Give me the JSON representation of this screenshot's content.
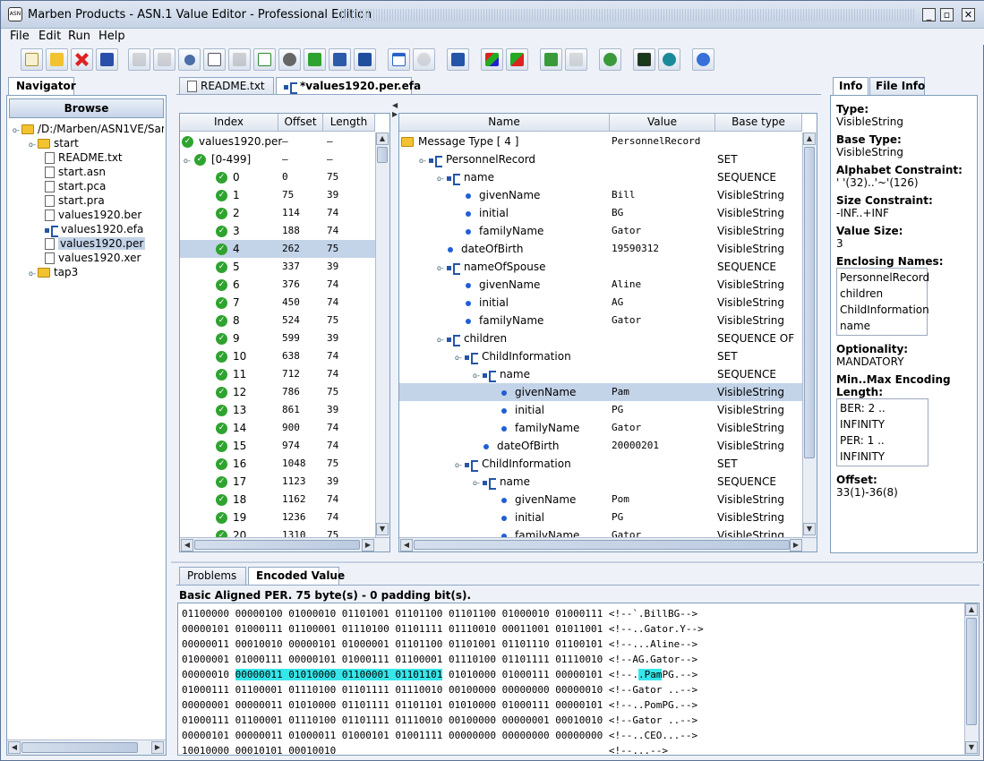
{
  "window": {
    "title": "Marben Products - ASN.1 Value Editor - Professional Edition"
  },
  "menu": [
    "File",
    "Edit",
    "Run",
    "Help"
  ],
  "navigator": {
    "tab": "Navigator",
    "browse_label": "Browse",
    "tree": [
      {
        "label": "/D:/Marben/ASN1VE/Sample",
        "icon": "folder-icon",
        "level": 0
      },
      {
        "label": "start",
        "icon": "folder-icon",
        "level": 1
      },
      {
        "label": "README.txt",
        "icon": "file-icon",
        "level": 2
      },
      {
        "label": "start.asn",
        "icon": "asn-file-icon",
        "level": 2
      },
      {
        "label": "start.pca",
        "icon": "pca-file-icon",
        "level": 2
      },
      {
        "label": "start.pra",
        "icon": "pra-file-icon",
        "level": 2
      },
      {
        "label": "values1920.ber",
        "icon": "file-icon",
        "level": 2
      },
      {
        "label": "values1920.efa",
        "icon": "efa-file-icon",
        "level": 2
      },
      {
        "label": "values1920.per",
        "icon": "file-icon",
        "level": 2,
        "selected": true
      },
      {
        "label": "values1920.xer",
        "icon": "file-icon",
        "level": 2
      },
      {
        "label": "tap3",
        "icon": "folder-icon",
        "level": 1
      }
    ]
  },
  "editor_tabs": [
    "README.txt",
    "*values1920.per.efa"
  ],
  "index_table": {
    "headers": [
      "Index",
      "Offset",
      "Length"
    ],
    "root": {
      "label": "values1920.per",
      "offset": "–",
      "length": "–"
    },
    "range": {
      "label": "[0-499]",
      "offset": "–",
      "length": "–"
    },
    "rows": [
      {
        "index": "0",
        "offset": "0",
        "length": "75"
      },
      {
        "index": "1",
        "offset": "75",
        "length": "39"
      },
      {
        "index": "2",
        "offset": "114",
        "length": "74"
      },
      {
        "index": "3",
        "offset": "188",
        "length": "74"
      },
      {
        "index": "4",
        "offset": "262",
        "length": "75",
        "selected": true
      },
      {
        "index": "5",
        "offset": "337",
        "length": "39"
      },
      {
        "index": "6",
        "offset": "376",
        "length": "74"
      },
      {
        "index": "7",
        "offset": "450",
        "length": "74"
      },
      {
        "index": "8",
        "offset": "524",
        "length": "75"
      },
      {
        "index": "9",
        "offset": "599",
        "length": "39"
      },
      {
        "index": "10",
        "offset": "638",
        "length": "74"
      },
      {
        "index": "11",
        "offset": "712",
        "length": "74"
      },
      {
        "index": "12",
        "offset": "786",
        "length": "75"
      },
      {
        "index": "13",
        "offset": "861",
        "length": "39"
      },
      {
        "index": "14",
        "offset": "900",
        "length": "74"
      },
      {
        "index": "15",
        "offset": "974",
        "length": "74"
      },
      {
        "index": "16",
        "offset": "1048",
        "length": "75"
      },
      {
        "index": "17",
        "offset": "1123",
        "length": "39"
      },
      {
        "index": "18",
        "offset": "1162",
        "length": "74"
      },
      {
        "index": "19",
        "offset": "1236",
        "length": "74"
      },
      {
        "index": "20",
        "offset": "1310",
        "length": "75"
      }
    ]
  },
  "value_tree": {
    "headers": [
      "Name",
      "Value",
      "Base type"
    ],
    "rows": [
      {
        "name": "Message Type [ 4 ]",
        "value": "PersonnelRecord",
        "type": "",
        "level": 0,
        "icon": "folder"
      },
      {
        "name": "PersonnelRecord",
        "value": "",
        "type": "SET",
        "level": 1,
        "icon": "struct"
      },
      {
        "name": "name",
        "value": "",
        "type": "SEQUENCE",
        "level": 2,
        "icon": "struct"
      },
      {
        "name": "givenName",
        "value": "Bill",
        "type": "VisibleString",
        "level": 3,
        "icon": "dot"
      },
      {
        "name": "initial",
        "value": "BG",
        "type": "VisibleString",
        "level": 3,
        "icon": "dot"
      },
      {
        "name": "familyName",
        "value": "Gator",
        "type": "VisibleString",
        "level": 3,
        "icon": "dot"
      },
      {
        "name": "dateOfBirth",
        "value": "19590312",
        "type": "VisibleString",
        "level": 2,
        "icon": "dot"
      },
      {
        "name": "nameOfSpouse",
        "value": "",
        "type": "SEQUENCE",
        "level": 2,
        "icon": "struct"
      },
      {
        "name": "givenName",
        "value": "Aline",
        "type": "VisibleString",
        "level": 3,
        "icon": "dot"
      },
      {
        "name": "initial",
        "value": "AG",
        "type": "VisibleString",
        "level": 3,
        "icon": "dot"
      },
      {
        "name": "familyName",
        "value": "Gator",
        "type": "VisibleString",
        "level": 3,
        "icon": "dot"
      },
      {
        "name": "children",
        "value": "",
        "type": "SEQUENCE OF",
        "level": 2,
        "icon": "struct"
      },
      {
        "name": "ChildInformation",
        "value": "",
        "type": "SET",
        "level": 3,
        "icon": "struct"
      },
      {
        "name": "name",
        "value": "",
        "type": "SEQUENCE",
        "level": 4,
        "icon": "struct"
      },
      {
        "name": "givenName",
        "value": "Pam",
        "type": "VisibleString",
        "level": 5,
        "icon": "dot",
        "selected": true
      },
      {
        "name": "initial",
        "value": "PG",
        "type": "VisibleString",
        "level": 5,
        "icon": "dot"
      },
      {
        "name": "familyName",
        "value": "Gator",
        "type": "VisibleString",
        "level": 5,
        "icon": "dot"
      },
      {
        "name": "dateOfBirth",
        "value": "20000201",
        "type": "VisibleString",
        "level": 4,
        "icon": "dot"
      },
      {
        "name": "ChildInformation",
        "value": "",
        "type": "SET",
        "level": 3,
        "icon": "struct"
      },
      {
        "name": "name",
        "value": "",
        "type": "SEQUENCE",
        "level": 4,
        "icon": "struct"
      },
      {
        "name": "givenName",
        "value": "Pom",
        "type": "VisibleString",
        "level": 5,
        "icon": "dot"
      },
      {
        "name": "initial",
        "value": "PG",
        "type": "VisibleString",
        "level": 5,
        "icon": "dot"
      },
      {
        "name": "familyName",
        "value": "Gator",
        "type": "VisibleString",
        "level": 5,
        "icon": "dot"
      }
    ]
  },
  "info": {
    "tabs": [
      "Info",
      "File Info"
    ],
    "type_label": "Type:",
    "type": "VisibleString",
    "base_type_label": "Base Type:",
    "base_type": "VisibleString",
    "alphabet_label": "Alphabet Constraint:",
    "alphabet": "' '(32)..'~'(126)",
    "size_label": "Size Constraint:",
    "size": "-INF..+INF",
    "value_size_label": "Value Size:",
    "value_size": "3",
    "enclosing_label": "Enclosing Names:",
    "enclosing": [
      "PersonnelRecord",
      "children",
      "ChildInformation",
      "name"
    ],
    "optionality_label": "Optionality:",
    "optionality": "MANDATORY",
    "minmax_label": "Min..Max Encoding Length:",
    "minmax": [
      "BER: 2 .. INFINITY",
      "PER: 1 .. INFINITY"
    ],
    "offset_label": "Offset:",
    "offset": "33(1)-36(8)"
  },
  "bottom": {
    "tabs": [
      "Problems",
      "Encoded Value"
    ],
    "summary": "Basic Aligned PER. 75 byte(s) - 0 padding bit(s).",
    "lines": [
      {
        "pre": "01100000 00000100 01000010 01101001 01101100 01101100 01000010 01000111 <!--`.BillBG-->",
        "hl": "",
        "mid": "",
        "hl2": "",
        "post": ""
      },
      {
        "pre": "00000101 01000111 01100001 01110100 01101111 01110010 00011001 01011001 <!--..Gator.Y-->",
        "hl": "",
        "mid": "",
        "hl2": "",
        "post": ""
      },
      {
        "pre": "00000011 00010010 00000101 01000001 01101100 01101001 01101110 01100101 <!--...Aline-->",
        "hl": "",
        "mid": "",
        "hl2": "",
        "post": ""
      },
      {
        "pre": "01000001 01000111 00000101 01000111 01100001 01110100 01101111 01110010 <!--AG.Gator-->",
        "hl": "",
        "mid": "",
        "hl2": "",
        "post": ""
      },
      {
        "pre": "00000010 ",
        "hl": "00000011 01010000 01100001 01101101",
        "mid": " 01010000 01000111 00000101 <!--.",
        "hl2": ".Pam",
        "post": "PG.-->"
      },
      {
        "pre": "01000111 01100001 01110100 01101111 01110010 00100000 00000000 00000010 <!--Gator ..-->",
        "hl": "",
        "mid": "",
        "hl2": "",
        "post": ""
      },
      {
        "pre": "00000001 00000011 01010000 01101111 01101101 01010000 01000111 00000101 <!--..PomPG.-->",
        "hl": "",
        "mid": "",
        "hl2": "",
        "post": ""
      },
      {
        "pre": "01000111 01100001 01110100 01101111 01110010 00100000 00000001 00010010 <!--Gator ..-->",
        "hl": "",
        "mid": "",
        "hl2": "",
        "post": ""
      },
      {
        "pre": "00000101 00000011 01000011 01000101 01001111 00000000 00000000 00000000 <!--..CEO...-->",
        "hl": "",
        "mid": "",
        "hl2": "",
        "post": ""
      },
      {
        "pre": "10010000 00010101 00010010                                              <!--...-->",
        "hl": "",
        "mid": "",
        "hl2": "",
        "post": ""
      }
    ]
  }
}
